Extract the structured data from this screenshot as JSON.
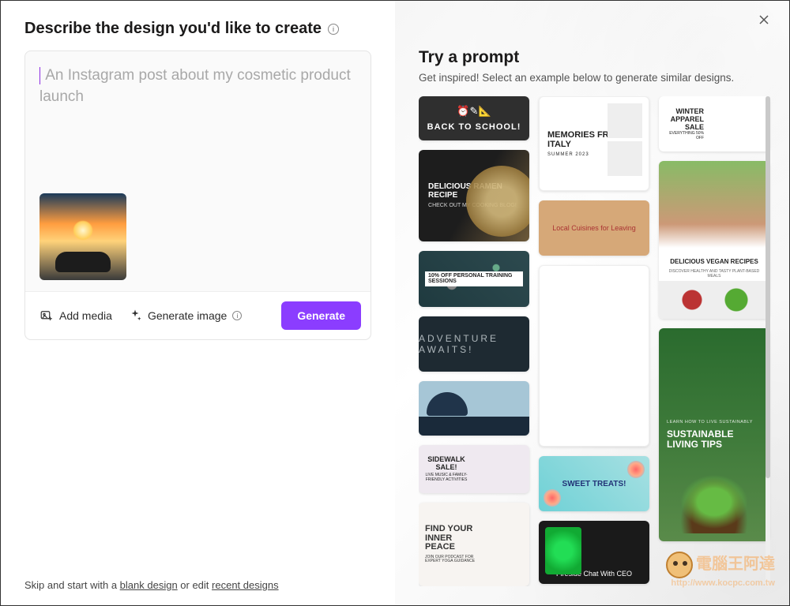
{
  "left": {
    "title": "Describe the design you'd like to create",
    "placeholder": "An Instagram post about my cosmetic product launch",
    "add_media": "Add media",
    "generate_image": "Generate image",
    "generate_btn": "Generate",
    "skip_pre": "Skip and start with a ",
    "skip_blank": "blank design",
    "skip_mid": " or edit ",
    "skip_recent": "recent designs"
  },
  "right": {
    "title": "Try a prompt",
    "subtitle": "Get inspired! Select an example below to generate similar designs.",
    "cards": {
      "back_to_school": "BACK TO SCHOOL!",
      "ramen": {
        "title": "DELICIOUS RAMEN RECIPE",
        "sub": "CHECK OUT MY COOKING BLOG!"
      },
      "trainer": "10% OFF PERSONAL TRAINING SESSIONS",
      "adventure": "ADVENTURE AWAITS!",
      "sidewalk": {
        "title": "SIDEWALK SALE!",
        "sub": "LIVE MUSIC & FAMILY-FRIENDLY ACTIVITIES"
      },
      "peace": {
        "title": "FIND YOUR INNER PEACE",
        "sub": "JOIN OUR PODCAST FOR EXPERT YOGA GUIDANCE"
      },
      "memories": {
        "title": "MEMORIES FROM ITALY",
        "sub": "SUMMER 2023"
      },
      "cuisines": "Local Cuisines for Leaving",
      "sweet": "SWEET TREATS!",
      "fireside": "Fireside Chat With CEO",
      "winter": {
        "title": "WINTER APPAREL SALE",
        "sub": "EVERYTHING 50% OFF"
      },
      "vegan": {
        "title": "DELICIOUS VEGAN RECIPES",
        "sub": "DISCOVER HEALTHY AND TASTY PLANT-BASED MEALS"
      },
      "sustain": {
        "pre": "LEARN HOW TO LIVE SUSTAINABLY",
        "title": "SUSTAINABLE LIVING TIPS"
      }
    }
  },
  "watermark": {
    "text": "電腦王阿達",
    "url": "http://www.kocpc.com.tw"
  }
}
